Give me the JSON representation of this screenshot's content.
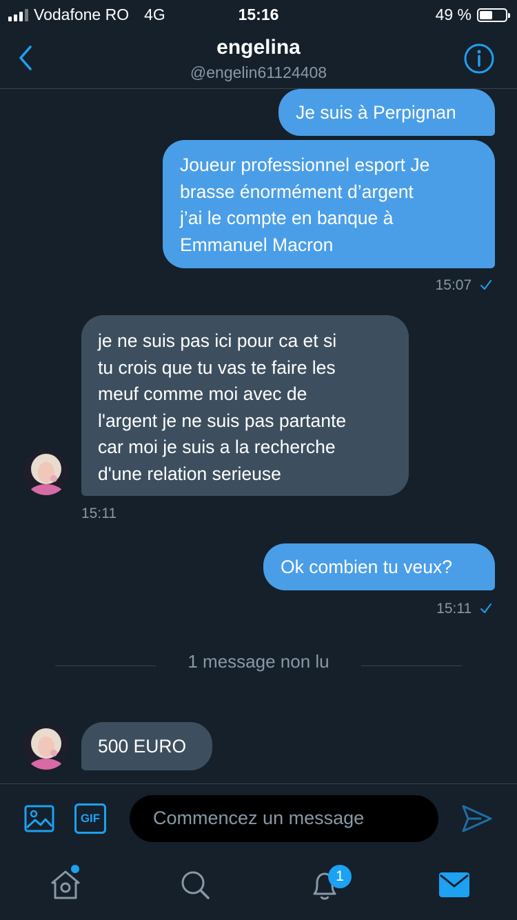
{
  "status_bar": {
    "carrier": "Vodafone RO",
    "network": "4G",
    "time": "15:16",
    "battery_percent_label": "49 %",
    "battery_level": 0.49
  },
  "header": {
    "name": "engelina",
    "handle": "@engelin61124408"
  },
  "messages": [
    {
      "direction": "out",
      "text": "Je suis à Perpignan"
    },
    {
      "direction": "out",
      "lines": [
        "Joueur professionnel esport Je",
        "brasse énormément d’argent",
        "j’ai le compte en banque à",
        "Emmanuel Macron"
      ],
      "time": "15:07"
    },
    {
      "direction": "in",
      "lines": [
        "je ne suis pas ici pour ca et si",
        "tu crois que tu vas te faire les",
        "meuf comme moi avec de",
        "l'argent je ne suis pas partante",
        "car moi je suis a la recherche",
        "d'une relation serieuse"
      ],
      "time": "15:11"
    },
    {
      "direction": "out",
      "text": "Ok combien tu veux?",
      "time": "15:11"
    },
    {
      "direction": "in",
      "text": "500 EURO"
    }
  ],
  "unread_label": "1 message non lu",
  "composer": {
    "placeholder": "Commencez un message",
    "gif_label": "GIF"
  },
  "tabs": {
    "notifications_badge": "1"
  },
  "colors": {
    "background": "#15202b",
    "outgoing_bubble": "#4a9ee8",
    "incoming_bubble": "#3d4f5f",
    "accent": "#1da1f2",
    "muted_text": "#8899a6"
  },
  "icons": [
    "back-chevron-icon",
    "info-icon",
    "read-check-icon",
    "image-icon",
    "gif-icon",
    "send-icon",
    "home-icon",
    "search-icon",
    "bell-icon",
    "mail-icon"
  ]
}
